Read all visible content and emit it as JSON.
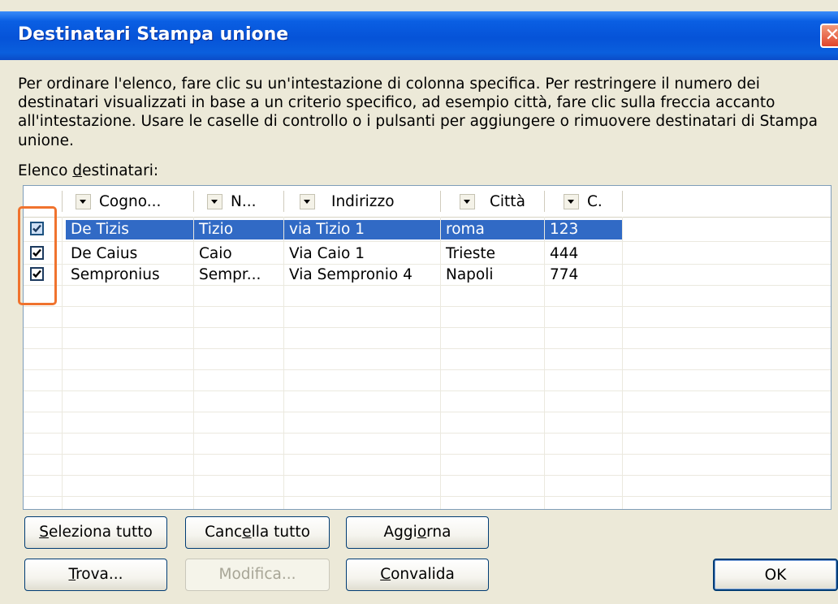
{
  "window": {
    "title": "Destinatari Stampa unione",
    "close_glyph": "✕"
  },
  "instructions": [
    "Per ordinare l'elenco, fare clic su un'intestazione di colonna specifica. Per restringere il numero dei",
    "destinatari visualizzati in base a un criterio specifico, ad esempio città, fare clic sulla freccia accanto",
    "all'intestazione. Usare le caselle di controllo o i pulsanti per aggiungere o rimuovere destinatari di Stampa",
    "unione."
  ],
  "list_label": {
    "before": "Elenco ",
    "accel": "d",
    "after": "estinatari:"
  },
  "columns": [
    {
      "label": "Cogno..."
    },
    {
      "label": "N..."
    },
    {
      "label": "Indirizzo"
    },
    {
      "label": "Città"
    },
    {
      "label": "C."
    }
  ],
  "rows": [
    {
      "checked": true,
      "selected": true,
      "cells": [
        "De Tizis",
        "Tizio",
        "via Tizio 1",
        "roma",
        "123"
      ]
    },
    {
      "checked": true,
      "selected": false,
      "cells": [
        "De Caius",
        "Caio",
        "Via Caio 1",
        "Trieste",
        "444"
      ]
    },
    {
      "checked": true,
      "selected": false,
      "cells": [
        "Sempronius",
        "Sempr...",
        "Via Sempronio 4",
        "Napoli",
        "774"
      ]
    }
  ],
  "buttons": {
    "select_all": {
      "before": "",
      "accel": "S",
      "after": "eleziona tutto"
    },
    "clear_all": {
      "before": "Canc",
      "accel": "e",
      "after": "lla tutto"
    },
    "refresh": {
      "before": "Aggi",
      "accel": "o",
      "after": "rna"
    },
    "find": {
      "before": "",
      "accel": "T",
      "after": "rova..."
    },
    "edit": {
      "label": "Modifica..."
    },
    "validate": {
      "before": "",
      "accel": "C",
      "after": "onvalida"
    },
    "ok": {
      "label": "OK"
    }
  },
  "colors": {
    "title_bar": "#0653d8",
    "selection": "#316ac5",
    "highlight_box": "#f0732e",
    "dialog_bg": "#ece9d8"
  },
  "icons": {
    "checkbox": "checkmark-icon",
    "column_dropdown": "dropdown-arrow-icon",
    "close": "close-icon"
  }
}
